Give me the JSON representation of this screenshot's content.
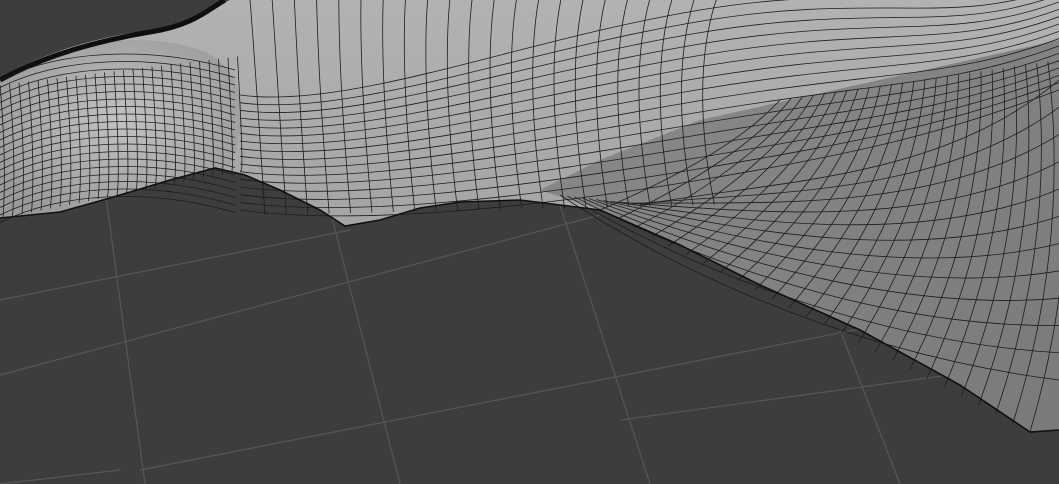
{
  "viewport": {
    "name": "3d-viewport",
    "colors": {
      "background": "#3d3d3d",
      "grid_line": "#555555",
      "mesh_light": "#a9a9a9",
      "mesh_mid": "#8f8f8f",
      "mesh_shadow": "#6e6e6e",
      "wire": "#1a1a1a",
      "silhouette": "#0f0f0f"
    },
    "mesh": {
      "display_mode": "solid-with-wireframe",
      "object": "sculpted-surface"
    }
  }
}
